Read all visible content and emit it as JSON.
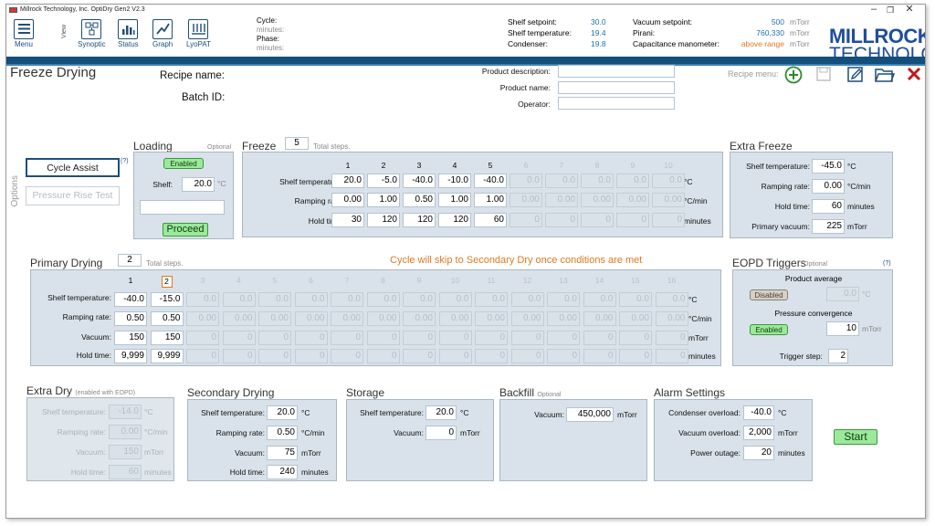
{
  "window": {
    "title": "Millrock Technology, Inc.  OptiDry Gen2 V2.3"
  },
  "toolbar": {
    "menu": "Menu",
    "view": "View",
    "synoptic": "Synoptic",
    "status": "Status",
    "graph": "Graph",
    "lyopat": "LyoPAT"
  },
  "cycle": {
    "cycle_label": "Cycle:",
    "cycle_minutes": "minutes:",
    "phase_label": "Phase:",
    "phase_minutes": "minutes:"
  },
  "status": {
    "shelf_setpoint_label": "Shelf setpoint:",
    "shelf_setpoint": "30.0",
    "shelf_temp_label": "Shelf temperature:",
    "shelf_temp": "19.4",
    "condenser_label": "Condenser:",
    "condenser": "19.8",
    "vacuum_setpoint_label": "Vacuum setpoint:",
    "vacuum_setpoint": "500",
    "vacuum_setpoint_unit": "mTorr",
    "pirani_label": "Pirani:",
    "pirani": "760,330",
    "pirani_unit": "mTorr",
    "cap_label": "Capacitance manometer:",
    "cap": "above range",
    "cap_unit": "mTorr"
  },
  "logo": {
    "line1": "MILLROCK",
    "line2": "TECHNOLOGY"
  },
  "page": {
    "title": "Freeze Drying",
    "recipe_name": "Recipe name:",
    "batch_id": "Batch ID:",
    "product_description": "Product description:",
    "product_name": "Product name:",
    "operator": "Operator:",
    "recipe_menu": "Recipe menu:"
  },
  "options": {
    "label": "Options",
    "cycle_assist": "Cycle Assist",
    "cycle_assist_help": "(?)",
    "pressure_rise": "Pressure Rise Test"
  },
  "loading": {
    "title": "Loading",
    "optional": "Optional",
    "enabled": "Enabled",
    "shelf_label": "Shelf:",
    "shelf": "20.0",
    "unit": "°C",
    "proceed": "Proceed"
  },
  "freeze": {
    "title": "Freeze",
    "steps": "5",
    "steps_label": "Total steps.",
    "cols": [
      "1",
      "2",
      "3",
      "4",
      "5",
      "6",
      "7",
      "8",
      "9",
      "10"
    ],
    "shelf_label": "Shelf temperature:",
    "ramp_label": "Ramping rate:",
    "hold_label": "Hold time:",
    "shelf": [
      "20.0",
      "-5.0",
      "-40.0",
      "-10.0",
      "-40.0",
      "0.0",
      "0.0",
      "0.0",
      "0.0",
      "0.0"
    ],
    "ramp": [
      "0.00",
      "1.00",
      "0.50",
      "1.00",
      "1.00",
      "0.00",
      "0.00",
      "0.00",
      "0.00",
      "0.00"
    ],
    "hold": [
      "30",
      "120",
      "120",
      "120",
      "60",
      "0",
      "0",
      "0",
      "0",
      "0"
    ],
    "u_shelf": "°C",
    "u_ramp": "°C/min",
    "u_hold": "minutes"
  },
  "extra_freeze": {
    "title": "Extra Freeze",
    "shelf_label": "Shelf temperature:",
    "shelf": "-45.0",
    "u_shelf": "°C",
    "ramp_label": "Ramping rate:",
    "ramp": "0.00",
    "u_ramp": "°C/min",
    "hold_label": "Hold time:",
    "hold": "60",
    "u_hold": "minutes",
    "vac_label": "Primary vacuum:",
    "vac": "225",
    "u_vac": "mTorr"
  },
  "primary": {
    "title": "Primary Drying",
    "steps": "2",
    "steps_label": "Total steps.",
    "skip_msg": "Cycle will skip to Secondary Dry once conditions are met",
    "cols": [
      "1",
      "2",
      "3",
      "4",
      "5",
      "6",
      "7",
      "8",
      "9",
      "10",
      "11",
      "12",
      "13",
      "14",
      "15",
      "16"
    ],
    "shelf_label": "Shelf temperature:",
    "ramp_label": "Ramping rate:",
    "vac_label": "Vacuum:",
    "hold_label": "Hold time:",
    "shelf": [
      "-40.0",
      "-15.0",
      "0.0",
      "0.0",
      "0.0",
      "0.0",
      "0.0",
      "0.0",
      "0.0",
      "0.0",
      "0.0",
      "0.0",
      "0.0",
      "0.0",
      "0.0",
      "0.0"
    ],
    "ramp": [
      "0.50",
      "0.50",
      "0.00",
      "0.00",
      "0.00",
      "0.00",
      "0.00",
      "0.00",
      "0.00",
      "0.00",
      "0.00",
      "0.00",
      "0.00",
      "0.00",
      "0.00",
      "0.00"
    ],
    "vac": [
      "150",
      "150",
      "0",
      "0",
      "0",
      "0",
      "0",
      "0",
      "0",
      "0",
      "0",
      "0",
      "0",
      "0",
      "0",
      "0"
    ],
    "hold": [
      "9,999",
      "9,999",
      "0",
      "0",
      "0",
      "0",
      "0",
      "0",
      "0",
      "0",
      "0",
      "0",
      "0",
      "0",
      "0",
      "0"
    ],
    "u_shelf": "°C",
    "u_ramp": "°C/min",
    "u_vac": "mTorr",
    "u_hold": "minutes"
  },
  "eopd": {
    "title": "EOPD Triggers",
    "optional": "Optional",
    "help": "(?)",
    "product_avg": "Product average",
    "disabled": "Disabled",
    "pa_val": "0.0",
    "pa_unit": "°C",
    "pressure_conv": "Pressure convergence",
    "enabled": "Enabled",
    "pc_val": "10",
    "pc_unit": "mTorr",
    "trigger_label": "Trigger step:",
    "trigger": "2"
  },
  "extra_dry": {
    "title": "Extra Dry",
    "note": "(enabled with EOPD)",
    "shelf_label": "Shelf temperature:",
    "shelf": "-14.0",
    "u_shelf": "°C",
    "ramp_label": "Ramping rate:",
    "ramp": "0.00",
    "u_ramp": "°C/min",
    "vac_label": "Vacuum:",
    "vac": "150",
    "u_vac": "mTorr",
    "hold_label": "Hold time:",
    "hold": "60",
    "u_hold": "minutes"
  },
  "secondary": {
    "title": "Secondary Drying",
    "shelf_label": "Shelf temperature:",
    "shelf": "20.0",
    "u_shelf": "°C",
    "ramp_label": "Ramping rate:",
    "ramp": "0.50",
    "u_ramp": "°C/min",
    "vac_label": "Vacuum:",
    "vac": "75",
    "u_vac": "mTorr",
    "hold_label": "Hold time:",
    "hold": "240",
    "u_hold": "minutes"
  },
  "storage": {
    "title": "Storage",
    "shelf_label": "Shelf temperature:",
    "shelf": "20.0",
    "u_shelf": "°C",
    "vac_label": "Vacuum:",
    "vac": "0",
    "u_vac": "mTorr"
  },
  "backfill": {
    "title": "Backfill",
    "optional": "Optional",
    "vac_label": "Vacuum:",
    "vac": "450,000",
    "u_vac": "mTorr"
  },
  "alarm": {
    "title": "Alarm Settings",
    "cond_label": "Condenser overload:",
    "cond": "-40.0",
    "u_cond": "°C",
    "vac_label": "Vacuum overload:",
    "vac": "2,000",
    "u_vac": "mTorr",
    "power_label": "Power outage:",
    "power": "20",
    "u_power": "minutes"
  },
  "start": "Start",
  "colors": {
    "bluebar": "#144e7a",
    "accent": "#1f6fb5",
    "warning": "#e07820",
    "enabled": "#9ce89c"
  }
}
